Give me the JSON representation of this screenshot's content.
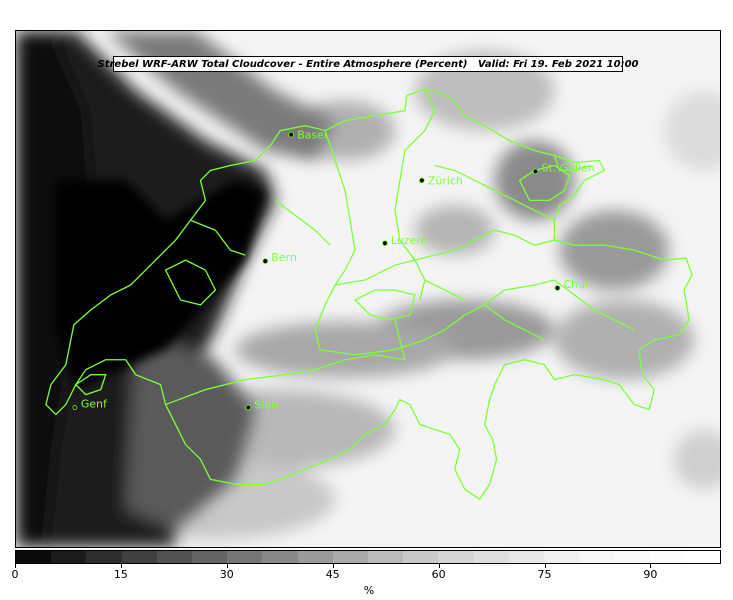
{
  "map": {
    "title": "Strebel WRF-ARW Total Cloudcover - Entire Atmosphere (Percent)   Valid: Fri 19. Feb 2021 10:00",
    "border_color": "#7cff3a",
    "cities": [
      {
        "name": "Basel"
      },
      {
        "name": "Zürich"
      },
      {
        "name": "St. Gallen"
      },
      {
        "name": "Luzern"
      },
      {
        "name": "Bern"
      },
      {
        "name": "Chur"
      },
      {
        "name": "Genf"
      },
      {
        "name": "Sion"
      }
    ]
  },
  "colorbar": {
    "unit": "%",
    "min": 0,
    "max": 100,
    "ticks": [
      "0",
      "15",
      "30",
      "45",
      "60",
      "75",
      "90"
    ],
    "colors": [
      "#0a0a0a",
      "#1c1c1c",
      "#2e2e2e",
      "#404040",
      "#525252",
      "#646464",
      "#767676",
      "#888888",
      "#9a9a9a",
      "#aaaaaa",
      "#bababa",
      "#c8c8c8",
      "#d4d4d4",
      "#dedede",
      "#e8e8e8",
      "#f0f0f0",
      "#f6f6f6",
      "#f9f9f9",
      "#fcfcfc",
      "#ffffff"
    ]
  }
}
